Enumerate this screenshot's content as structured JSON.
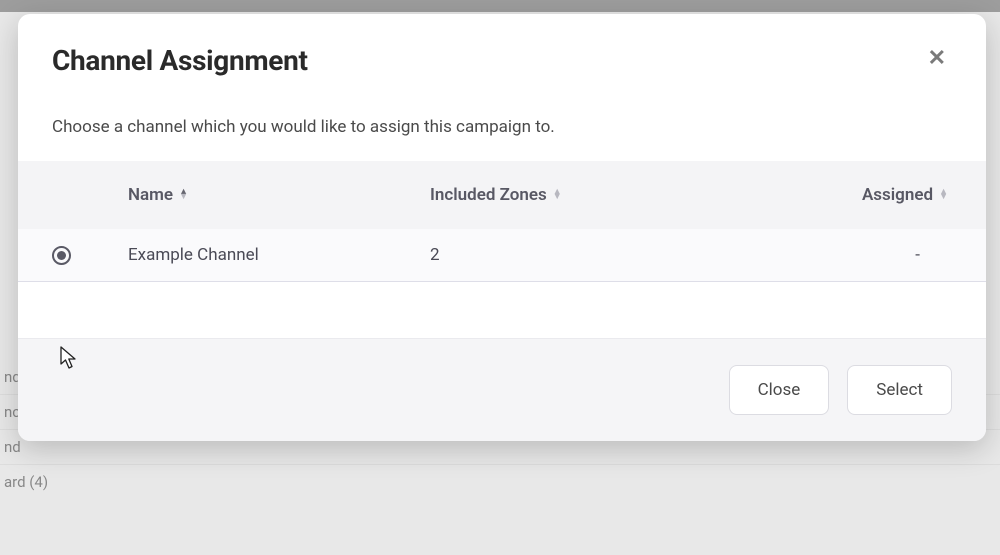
{
  "modal": {
    "title": "Channel Assignment",
    "subtitle": "Choose a channel which you would like to assign this campaign to.",
    "columns": {
      "name": "Name",
      "included_zones": "Included Zones",
      "assigned": "Assigned"
    },
    "rows": [
      {
        "name": "Example Channel",
        "included_zones": "2",
        "assigned": "-",
        "selected": true
      }
    ],
    "footer": {
      "close": "Close",
      "select": "Select"
    }
  },
  "background": {
    "fragments": [
      "nd",
      "nc",
      "nd",
      "ard (4)"
    ]
  }
}
